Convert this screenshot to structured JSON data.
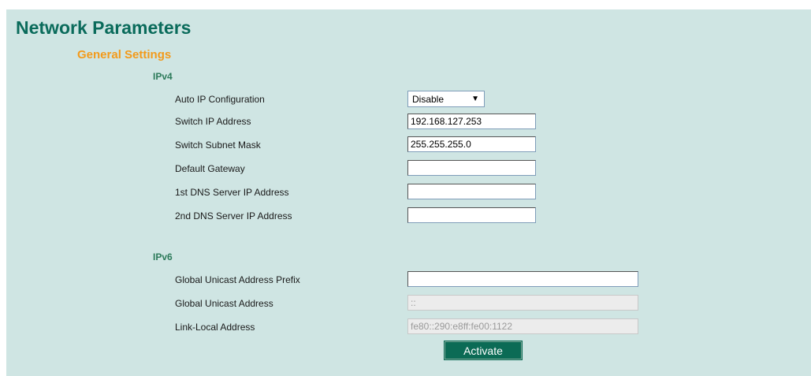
{
  "page_title": "Network Parameters",
  "section_title": "General Settings",
  "ipv4": {
    "title": "IPv4",
    "auto_ip": {
      "label": "Auto IP Configuration",
      "value": "Disable"
    },
    "switch_ip": {
      "label": "Switch IP Address",
      "value": "192.168.127.253"
    },
    "subnet_mask": {
      "label": "Switch Subnet Mask",
      "value": "255.255.255.0"
    },
    "gateway": {
      "label": "Default Gateway",
      "value": ""
    },
    "dns1": {
      "label": "1st DNS Server IP Address",
      "value": ""
    },
    "dns2": {
      "label": "2nd DNS Server IP Address",
      "value": ""
    }
  },
  "ipv6": {
    "title": "IPv6",
    "prefix": {
      "label": "Global Unicast Address Prefix",
      "value": ""
    },
    "global": {
      "label": "Global Unicast Address",
      "value": "::"
    },
    "link_local": {
      "label": "Link-Local Address",
      "value": "fe80::290:e8ff:fe00:1122"
    }
  },
  "activate_label": "Activate",
  "icons": {
    "dropdown_caret": "chevron-down-icon"
  }
}
